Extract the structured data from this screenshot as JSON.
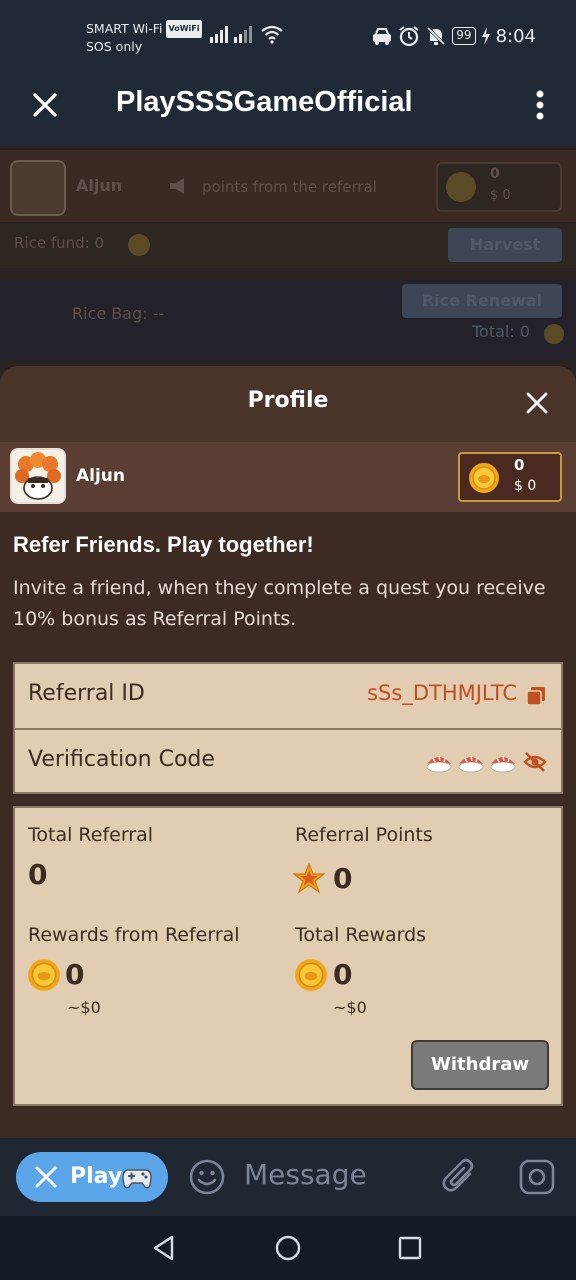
{
  "status_bar": {
    "carrier_line1": "SMART Wi-Fi",
    "vowifi_badge": "VoWiFi",
    "carrier_line2": "SOS only",
    "battery": "99",
    "time": "8:04"
  },
  "title_bar": {
    "title": "PlaySSSGameOfficial"
  },
  "game_background": {
    "username": "Aljun",
    "referral_notice": "points from the referral",
    "balance": "0",
    "balance_usd": "$ 0",
    "rice_fund_label": "Rice fund: 0",
    "harvest_label": "Harvest",
    "rice_bag_label": "Rice Bag: --",
    "rice_renewal_label": "Rice Renewal",
    "total_label": "Total: 0"
  },
  "profile": {
    "title": "Profile",
    "username": "Aljun",
    "balance": "0",
    "balance_usd": "$ 0",
    "refer_title": "Refer Friends. Play together!",
    "refer_desc": "Invite a friend, when they complete a quest you receive 10% bonus as Referral Points.",
    "referral_id_label": "Referral ID",
    "referral_id_value": "sSs_DTHMJLTC",
    "verification_label": "Verification Code",
    "stats": {
      "total_referral_label": "Total Referral",
      "total_referral_value": "0",
      "referral_points_label": "Referral Points",
      "referral_points_value": "0",
      "rewards_from_referral_label": "Rewards from Referral",
      "rewards_from_referral_value": "0",
      "rewards_from_referral_usd": "~$0",
      "total_rewards_label": "Total Rewards",
      "total_rewards_value": "0",
      "total_rewards_usd": "~$0"
    },
    "withdraw_label": "Withdraw"
  },
  "input_bar": {
    "play_label": "Play",
    "message_placeholder": "Message"
  },
  "colors": {
    "app_bg": "#1f2733",
    "sheet_bg": "#3d2a22",
    "card_bg": "#e2cdb2",
    "accent_orange": "#c0501e",
    "play_blue": "#5aa6e8"
  }
}
